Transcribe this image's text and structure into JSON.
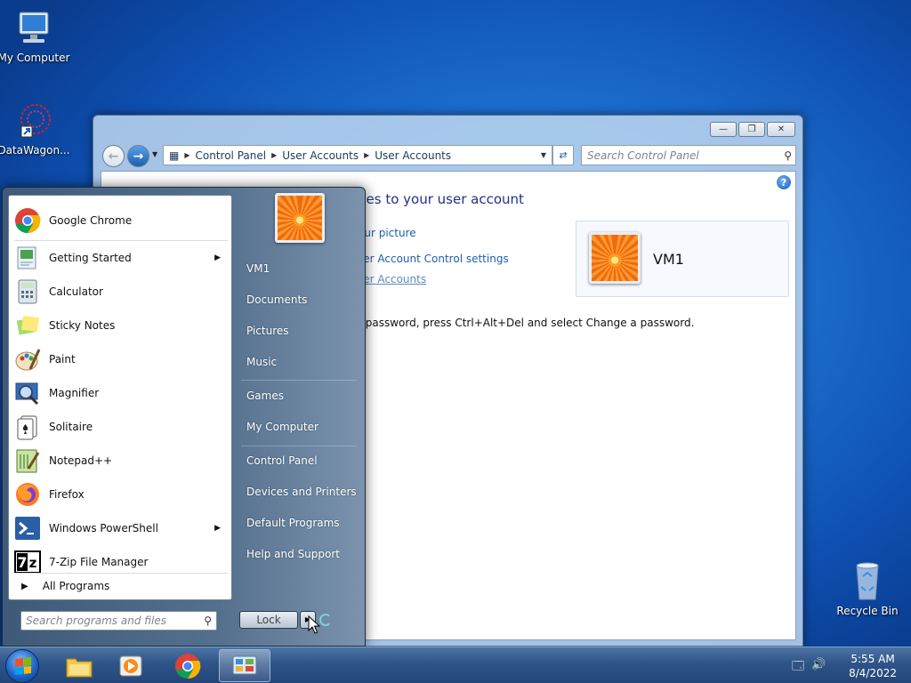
{
  "desktop": {
    "icons": [
      {
        "label": "My Computer",
        "icon": "computer-icon"
      },
      {
        "label": "DataWagon...",
        "icon": "datawagon-shortcut-icon"
      },
      {
        "label": "Recycle Bin",
        "icon": "recycle-bin-icon"
      }
    ]
  },
  "window": {
    "title": "User Accounts",
    "buttons": {
      "minimize": "—",
      "maximize": "❐",
      "close": "✕"
    },
    "breadcrumbs": [
      "Control Panel",
      "User Accounts",
      "User Accounts"
    ],
    "search_placeholder": "Search Control Panel",
    "heading": "ges to your user account",
    "links": [
      {
        "label": "our picture",
        "style": "normal"
      },
      {
        "label": "ser Account Control settings",
        "style": "normal"
      },
      {
        "label": "ser Accounts",
        "style": "underline"
      }
    ],
    "password_note": "r password, press Ctrl+Alt+Del and select Change a password.",
    "account": {
      "name": "VM1"
    }
  },
  "start_menu": {
    "programs": [
      {
        "label": "Google Chrome",
        "icon": "chrome-icon",
        "submenu": false
      },
      {
        "label": "Getting Started",
        "icon": "getting-started-icon",
        "submenu": true
      },
      {
        "label": "Calculator",
        "icon": "calculator-icon",
        "submenu": false
      },
      {
        "label": "Sticky Notes",
        "icon": "sticky-notes-icon",
        "submenu": false
      },
      {
        "label": "Paint",
        "icon": "paint-icon",
        "submenu": false
      },
      {
        "label": "Magnifier",
        "icon": "magnifier-icon",
        "submenu": false
      },
      {
        "label": "Solitaire",
        "icon": "solitaire-icon",
        "submenu": false
      },
      {
        "label": "Notepad++",
        "icon": "notepadpp-icon",
        "submenu": false
      },
      {
        "label": "Firefox",
        "icon": "firefox-icon",
        "submenu": false
      },
      {
        "label": "Windows PowerShell",
        "icon": "powershell-icon",
        "submenu": true
      },
      {
        "label": "7-Zip File Manager",
        "icon": "7zip-icon",
        "submenu": false
      }
    ],
    "all_programs": "All Programs",
    "search_placeholder": "Search programs and files",
    "right_items": [
      "VM1",
      "Documents",
      "Pictures",
      "Music",
      "Games",
      "My Computer",
      "Control Panel",
      "Devices and Printers",
      "Default Programs",
      "Help and Support"
    ],
    "lock_label": "Lock"
  },
  "taskbar": {
    "apps": [
      {
        "name": "explorer",
        "icon": "folder-icon"
      },
      {
        "name": "media-player",
        "icon": "media-player-icon"
      },
      {
        "name": "chrome",
        "icon": "chrome-icon"
      },
      {
        "name": "control-panel",
        "icon": "control-panel-icon",
        "active": true
      }
    ],
    "time": "5:55 AM",
    "date": "8/4/2022"
  },
  "colors": {
    "link": "#1e5fb0",
    "heading": "#1e3287",
    "desktop_blue": "#1c6fcf"
  }
}
